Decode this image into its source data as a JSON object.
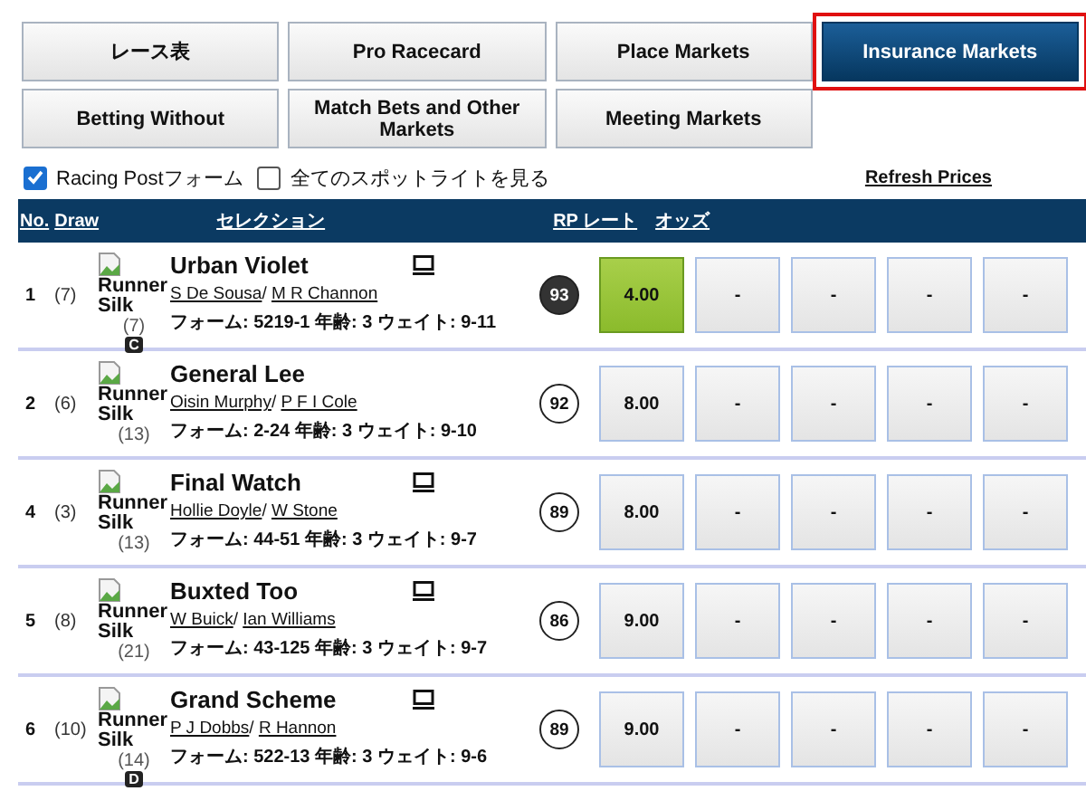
{
  "tabs": [
    {
      "label": "レース表",
      "selected": false
    },
    {
      "label": "Pro Racecard",
      "selected": false
    },
    {
      "label": "Place Markets",
      "selected": false
    },
    {
      "label": "Insurance Markets",
      "selected": true
    },
    {
      "label": "Betting Without",
      "selected": false
    },
    {
      "label": "Match Bets and Other Markets",
      "selected": false
    },
    {
      "label": "Meeting Markets",
      "selected": false
    }
  ],
  "options": [
    {
      "label": "Racing Postフォーム",
      "checked": true
    },
    {
      "label": "全てのスポットライトを見る",
      "checked": false
    }
  ],
  "refresh_link": "Refresh Prices",
  "name_separator": "/",
  "table": {
    "columns": [
      "No.",
      "Draw",
      "セレクション",
      "RP レート",
      "オッズ"
    ],
    "rows": [
      {
        "no": "1",
        "draw": "(7)",
        "silk": "Runner Silk",
        "silk_number": "(7)",
        "badge": "C",
        "name": "Urban Violet",
        "jockey": "S De Sousa",
        "trainer": "M R Channon",
        "details": "フォーム: 5219-1 年齢: 3 ウェイト: 9-11",
        "video": true,
        "rating": "93",
        "top_rated": true,
        "odds": [
          {
            "label": "4.00",
            "selected": true
          },
          {
            "label": "-",
            "selected": false
          },
          {
            "label": "-",
            "selected": false
          },
          {
            "label": "-",
            "selected": false
          },
          {
            "label": "-",
            "selected": false
          }
        ]
      },
      {
        "no": "2",
        "draw": "(6)",
        "silk": "Runner Silk",
        "silk_number": "(13)",
        "name": "General Lee",
        "jockey": "Oisin Murphy",
        "trainer": "P F I Cole",
        "details": "フォーム: 2-24 年齢: 3 ウェイト: 9-10",
        "video": false,
        "rating": "92",
        "top_rated": false,
        "odds": [
          {
            "label": "8.00",
            "selected": false
          },
          {
            "label": "-",
            "selected": false
          },
          {
            "label": "-",
            "selected": false
          },
          {
            "label": "-",
            "selected": false
          },
          {
            "label": "-",
            "selected": false
          }
        ]
      },
      {
        "no": "4",
        "draw": "(3)",
        "silk": "Runner Silk",
        "silk_number": "(13)",
        "name": "Final Watch",
        "jockey": "Hollie Doyle",
        "trainer": "W Stone",
        "details": "フォーム: 44-51 年齢: 3 ウェイト: 9-7",
        "video": true,
        "rating": "89",
        "top_rated": false,
        "odds": [
          {
            "label": "8.00",
            "selected": false
          },
          {
            "label": "-",
            "selected": false
          },
          {
            "label": "-",
            "selected": false
          },
          {
            "label": "-",
            "selected": false
          },
          {
            "label": "-",
            "selected": false
          }
        ]
      },
      {
        "no": "5",
        "draw": "(8)",
        "silk": "Runner Silk",
        "silk_number": "(21)",
        "name": "Buxted Too",
        "jockey": "W Buick",
        "trainer": "Ian Williams",
        "details": "フォーム: 43-125 年齢: 3 ウェイト: 9-7",
        "video": true,
        "rating": "86",
        "top_rated": false,
        "odds": [
          {
            "label": "9.00",
            "selected": false
          },
          {
            "label": "-",
            "selected": false
          },
          {
            "label": "-",
            "selected": false
          },
          {
            "label": "-",
            "selected": false
          },
          {
            "label": "-",
            "selected": false
          }
        ]
      },
      {
        "no": "6",
        "draw": "(10)",
        "silk": "Runner Silk",
        "silk_number": "(14)",
        "badge": "D",
        "name": "Grand Scheme",
        "jockey": "P J Dobbs",
        "trainer": "R Hannon",
        "details": "フォーム: 522-13 年齢: 3 ウェイト: 9-6",
        "video": true,
        "rating": "89",
        "top_rated": false,
        "odds": [
          {
            "label": "9.00",
            "selected": false
          },
          {
            "label": "-",
            "selected": false
          },
          {
            "label": "-",
            "selected": false
          },
          {
            "label": "-",
            "selected": false
          },
          {
            "label": "-",
            "selected": false
          }
        ]
      }
    ]
  }
}
